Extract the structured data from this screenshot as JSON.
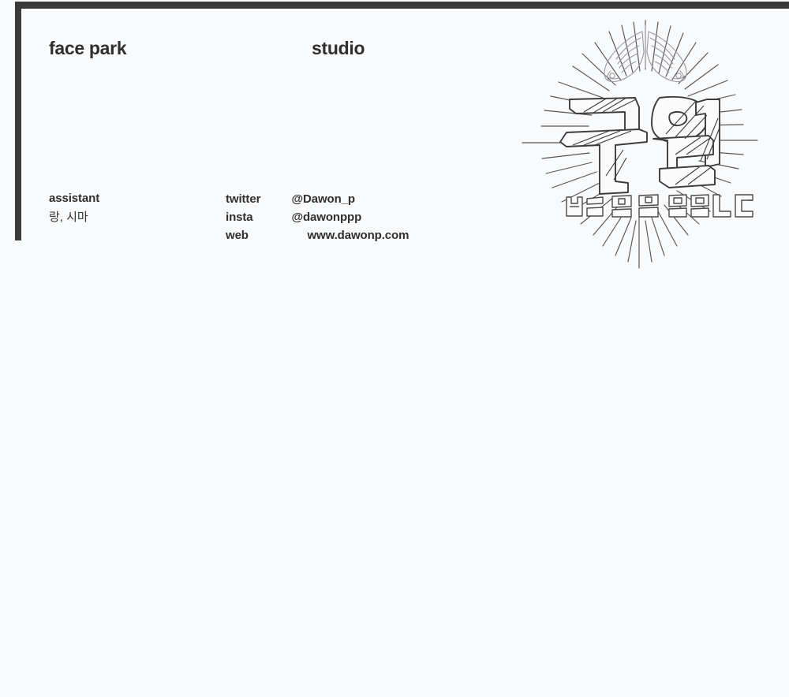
{
  "frame": {
    "border_color": "#3a3a3a",
    "background_color": "#f9fafb"
  },
  "header": {
    "studio_name": "face park",
    "studio_label": "studio"
  },
  "credits": {
    "assistant_label": "assistant",
    "assistant_names": "랑, 시마"
  },
  "contact": {
    "rows": [
      {
        "key": "twitter",
        "value": "@Dawon_p"
      },
      {
        "key": "insta",
        "value": "@dawonppp"
      },
      {
        "key": "web",
        "value": "www.dawonp.com"
      }
    ]
  },
  "logo": {
    "icon_name": "guwon-wings-logo",
    "wordmark": "구원",
    "subtitle": "하늘 별 참 쉽습니다",
    "line_color": "#3c3c3c",
    "wing_color": "#9a9aa2",
    "ray_color": "#555555"
  }
}
